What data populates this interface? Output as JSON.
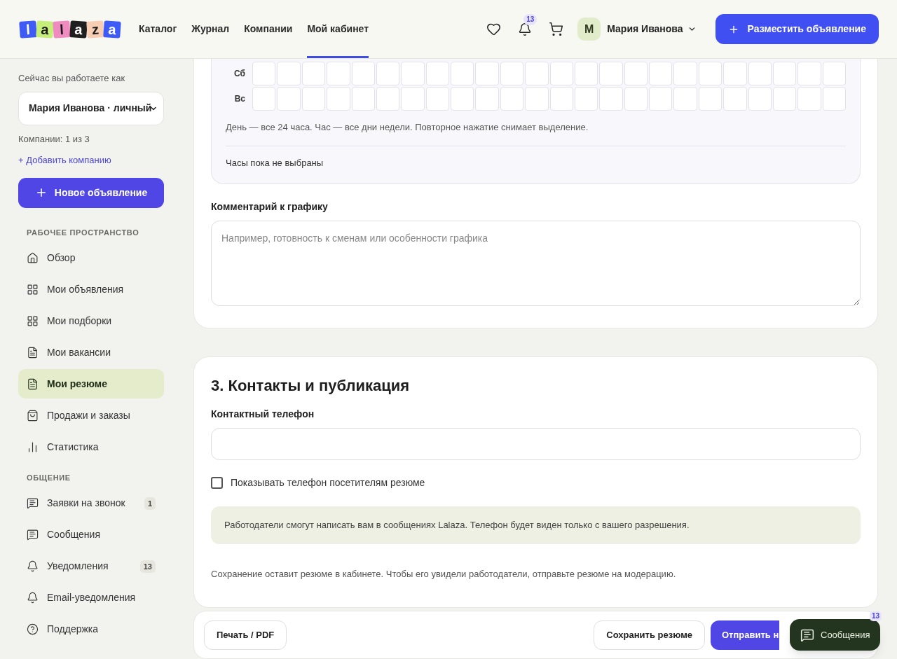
{
  "header": {
    "logo": [
      {
        "char": "l",
        "color": "#3f5bf6"
      },
      {
        "char": "a",
        "color": "#c6ee7a"
      },
      {
        "char": "l",
        "color": "#f08bc0"
      },
      {
        "char": "a",
        "color": "#1f1f1f"
      },
      {
        "char": "z",
        "color": "#f7cdb4"
      },
      {
        "char": "a",
        "color": "#3f5bf6"
      }
    ],
    "nav": [
      {
        "label": "Каталог",
        "selected": false
      },
      {
        "label": "Журнал",
        "selected": false
      },
      {
        "label": "Компании",
        "selected": false
      },
      {
        "label": "Мой кабинет",
        "selected": true
      }
    ],
    "notifications_badge": "13",
    "avatar_letter": "M",
    "user_name": "Мария Иванова",
    "post_button": "Разместить объявление"
  },
  "sidebar": {
    "working_as_label": "Сейчас вы работаете как",
    "account_select": "Мария Иванова · личный",
    "companies_count": "Компании: 1 из 3",
    "add_company_link": "+ Добавить компанию",
    "new_ad_button": "Новое объявление",
    "sections": [
      {
        "title": "РАБОЧЕЕ ПРОСТРАНСТВО",
        "items": [
          {
            "label": "Обзор",
            "selected": false
          },
          {
            "label": "Мои объявления",
            "selected": false
          },
          {
            "label": "Мои подборки",
            "selected": false
          },
          {
            "label": "Мои вакансии",
            "selected": false
          },
          {
            "label": "Мои резюме",
            "selected": true
          },
          {
            "label": "Продажи и заказы",
            "selected": false
          },
          {
            "label": "Статистика",
            "selected": false
          }
        ]
      },
      {
        "title": "ОБЩЕНИЕ",
        "items": [
          {
            "label": "Заявки на звонок",
            "selected": false,
            "badge": "1"
          },
          {
            "label": "Сообщения",
            "selected": false
          },
          {
            "label": "Уведомления",
            "selected": false,
            "badge": "13"
          },
          {
            "label": "Email-уведомления",
            "selected": false
          },
          {
            "label": "Поддержка",
            "selected": false
          }
        ]
      }
    ]
  },
  "schedule": {
    "rows": [
      {
        "day": "Сб",
        "slots": [
          {
            "selected": false
          },
          {
            "selected": false
          },
          {
            "selected": false
          },
          {
            "selected": false
          },
          {
            "selected": false
          },
          {
            "selected": false
          },
          {
            "selected": false
          },
          {
            "selected": false
          },
          {
            "selected": false
          },
          {
            "selected": false
          },
          {
            "selected": false
          },
          {
            "selected": false
          },
          {
            "selected": false
          },
          {
            "selected": false
          },
          {
            "selected": false
          },
          {
            "selected": false
          },
          {
            "selected": false
          },
          {
            "selected": false
          },
          {
            "selected": false
          },
          {
            "selected": false
          },
          {
            "selected": false
          },
          {
            "selected": false
          },
          {
            "selected": false
          },
          {
            "selected": false
          }
        ]
      },
      {
        "day": "Вс",
        "slots": [
          {
            "selected": false
          },
          {
            "selected": false
          },
          {
            "selected": false
          },
          {
            "selected": false
          },
          {
            "selected": false
          },
          {
            "selected": false
          },
          {
            "selected": false
          },
          {
            "selected": false
          },
          {
            "selected": false
          },
          {
            "selected": false
          },
          {
            "selected": false
          },
          {
            "selected": false
          },
          {
            "selected": false
          },
          {
            "selected": false
          },
          {
            "selected": false
          },
          {
            "selected": false
          },
          {
            "selected": false
          },
          {
            "selected": false
          },
          {
            "selected": false
          },
          {
            "selected": false
          },
          {
            "selected": false
          },
          {
            "selected": false
          },
          {
            "selected": false
          },
          {
            "selected": false
          }
        ]
      }
    ],
    "hint": "День — все 24 часа. Час — все дни недели. Повторное нажатие снимает выделение.",
    "status": "Часы пока не выбраны",
    "comment_label": "Комментарий к графику",
    "comment_placeholder": "Например, готовность к сменам или особенности графика"
  },
  "contacts": {
    "title": "3. Контакты и публикация",
    "phone_label": "Контактный телефон",
    "show_phone": {
      "label": "Показывать телефон посетителям резюме",
      "checked": false
    },
    "info": "Работодатели смогут написать вам в сообщениях Lalaza. Телефон будет виден только с вашего разрешения.",
    "note": "Сохранение оставит резюме в кабинете. Чтобы его увидели работодатели, отправьте резюме на модерацию."
  },
  "actions": {
    "print_button": "Печать / PDF",
    "save_button": "Сохранить резюме",
    "submit_button": "Отправить н"
  },
  "chat_widget": {
    "label": "Сообщения",
    "badge": "13"
  }
}
